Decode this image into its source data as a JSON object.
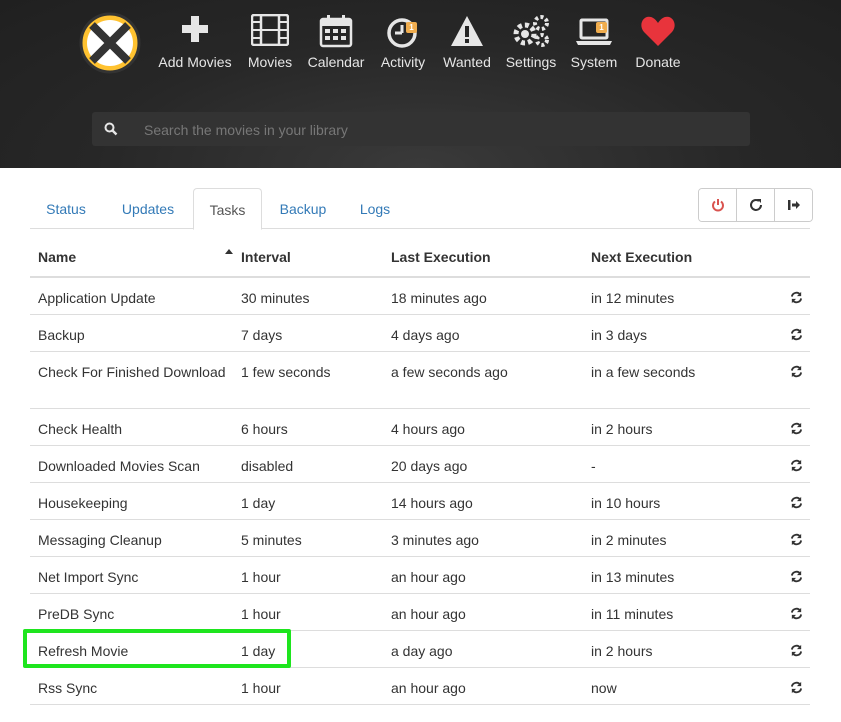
{
  "colors": {
    "accent": "#337ab7",
    "highlight": "#1ee51e",
    "donate": "#e8343c",
    "badge": "#f0ad4e"
  },
  "nav": [
    {
      "label": "Add Movies",
      "icon": "plus-icon"
    },
    {
      "label": "Movies",
      "icon": "film-icon"
    },
    {
      "label": "Calendar",
      "icon": "calendar-icon"
    },
    {
      "label": "Activity",
      "icon": "clock-icon",
      "badge": "1"
    },
    {
      "label": "Wanted",
      "icon": "warning-icon"
    },
    {
      "label": "Settings",
      "icon": "gears-icon"
    },
    {
      "label": "System",
      "icon": "laptop-icon",
      "badge": "1"
    },
    {
      "label": "Donate",
      "icon": "heart-icon"
    }
  ],
  "search": {
    "placeholder": "Search the movies in your library"
  },
  "tabs": [
    "Status",
    "Updates",
    "Tasks",
    "Backup",
    "Logs"
  ],
  "active_tab": "Tasks",
  "toolbar": {
    "restart": "power-icon",
    "reload": "refresh-icon",
    "logout": "sign-out-icon"
  },
  "table": {
    "headers": {
      "name": "Name",
      "interval": "Interval",
      "last": "Last Execution",
      "next": "Next Execution"
    },
    "rows": [
      {
        "name": "Application Update",
        "interval": "30 minutes",
        "last": "18 minutes ago",
        "next": "in 12 minutes"
      },
      {
        "name": "Backup",
        "interval": "7 days",
        "last": "4 days ago",
        "next": "in 3 days"
      },
      {
        "name": "Check For Finished Download",
        "interval": "1 few seconds",
        "last": "a few seconds ago",
        "next": "in a few seconds"
      },
      {
        "name": "Check Health",
        "interval": "6 hours",
        "last": "4 hours ago",
        "next": "in 2 hours"
      },
      {
        "name": "Downloaded Movies Scan",
        "interval": "disabled",
        "last": "20 days ago",
        "next": "-"
      },
      {
        "name": "Housekeeping",
        "interval": "1 day",
        "last": "14 hours ago",
        "next": "in 10 hours"
      },
      {
        "name": "Messaging Cleanup",
        "interval": "5 minutes",
        "last": "3 minutes ago",
        "next": "in 2 minutes"
      },
      {
        "name": "Net Import Sync",
        "interval": "1 hour",
        "last": "an hour ago",
        "next": "in 13 minutes"
      },
      {
        "name": "PreDB Sync",
        "interval": "1 hour",
        "last": "an hour ago",
        "next": "in 11 minutes"
      },
      {
        "name": "Refresh Movie",
        "interval": "1 day",
        "last": "a day ago",
        "next": "in 2 hours"
      },
      {
        "name": "Rss Sync",
        "interval": "1 hour",
        "last": "an hour ago",
        "next": "now"
      }
    ]
  }
}
